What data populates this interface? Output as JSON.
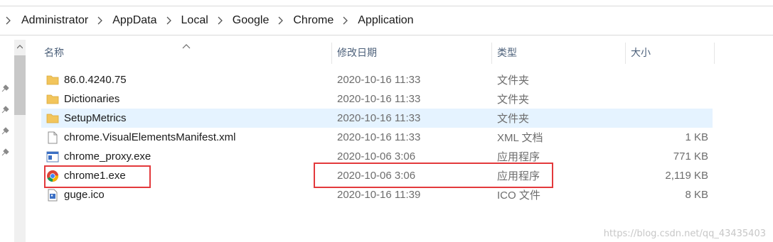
{
  "breadcrumb": {
    "items": [
      {
        "label": "Administrator"
      },
      {
        "label": "AppData"
      },
      {
        "label": "Local"
      },
      {
        "label": "Google"
      },
      {
        "label": "Chrome"
      },
      {
        "label": "Application"
      }
    ]
  },
  "columns": {
    "name": "名称",
    "date": "修改日期",
    "type": "类型",
    "size": "大小"
  },
  "files": [
    {
      "name": "86.0.4240.75",
      "date": "2020-10-16 11:33",
      "type": "文件夹",
      "size": "",
      "icon": "folder-icon"
    },
    {
      "name": "Dictionaries",
      "date": "2020-10-16 11:33",
      "type": "文件夹",
      "size": "",
      "icon": "folder-icon"
    },
    {
      "name": "SetupMetrics",
      "date": "2020-10-16 11:33",
      "type": "文件夹",
      "size": "",
      "icon": "folder-icon",
      "selected": true
    },
    {
      "name": "chrome.VisualElementsManifest.xml",
      "date": "2020-10-16 11:33",
      "type": "XML 文档",
      "size": "1 KB",
      "icon": "document-icon"
    },
    {
      "name": "chrome_proxy.exe",
      "date": "2020-10-06 3:06",
      "type": "应用程序",
      "size": "771 KB",
      "icon": "application-icon"
    },
    {
      "name": "chrome1.exe",
      "date": "2020-10-06 3:06",
      "type": "应用程序",
      "size": "2,119 KB",
      "icon": "chrome-icon"
    },
    {
      "name": "guge.ico",
      "date": "2020-10-16 11:39",
      "type": "ICO 文件",
      "size": "8 KB",
      "icon": "image-file-icon"
    }
  ],
  "watermark": "https://blog.csdn.net/qq_43435403",
  "colors": {
    "selection": "#e5f3ff",
    "highlight_box": "#e3393c",
    "folder": "#f2c55c"
  }
}
